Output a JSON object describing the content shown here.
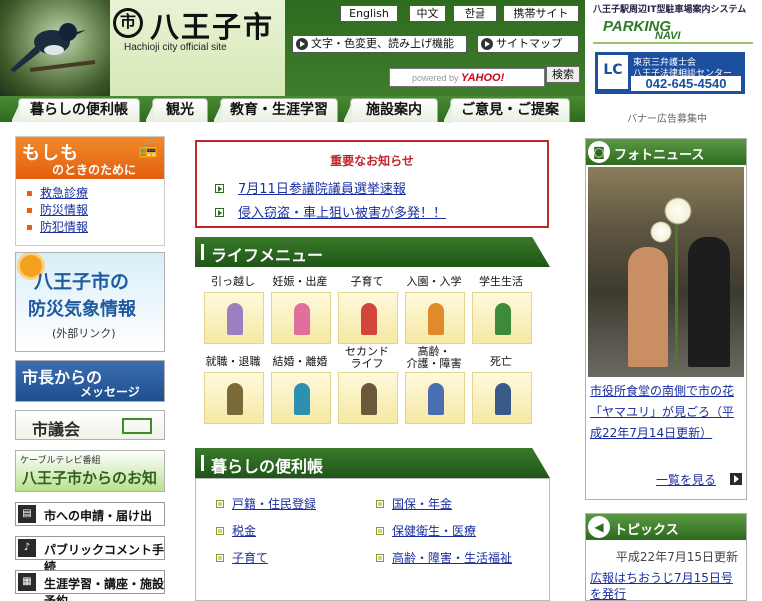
{
  "header": {
    "logo_mark": "市",
    "logo_title": "八王子市",
    "logo_subtitle": "Hachioji city official site",
    "languages": [
      "English",
      "中文",
      "한글",
      "携帯サイト"
    ],
    "accessibility_label": "文字・色変更、読み上げ機能",
    "sitemap_label": "サイトマップ",
    "search_placeholder": "powered by",
    "search_brand": "YAHOO!",
    "search_button": "検索"
  },
  "nav": {
    "tabs": [
      "暮らしの便利帳",
      "観光",
      "教育・生涯学習",
      "施設案内",
      "ご意見・ご提案"
    ]
  },
  "right_banners": {
    "parking_caption": "八王子駅周辺IT型駐車場案内システム",
    "parking_logo_1": "PARKING",
    "parking_logo_2": "NAVI",
    "lawyer_mark": "LC",
    "lawyer_line1": "東京三弁護士会",
    "lawyer_line2": "八王子法律相談センター",
    "lawyer_phone": "042-645-4540",
    "recruit": "バナー広告募集中"
  },
  "moshimo": {
    "title": "もしも",
    "subtitle": "のときのために",
    "icon": "radio-icon",
    "links": [
      "救急診療",
      "防災情報",
      "防犯情報"
    ]
  },
  "left_banners": {
    "bousai_line1": "八王子市の",
    "bousai_line2": "防災気象情報",
    "bousai_line3": "(外部リンク)",
    "mayor_line1": "市長からの",
    "mayor_line2": "メッセージ",
    "gikai": "市議会",
    "cable_line1": "ケーブルテレビ番組",
    "cable_line2": "八王子市からのお知らせ"
  },
  "left_buttons": [
    {
      "label": "市への申請・届け出",
      "icon": "document-icon"
    },
    {
      "label": "パブリックコメント手続",
      "icon": "microphone-icon"
    },
    {
      "label": "生涯学習・講座・施設予約",
      "icon": "grid-icon"
    }
  ],
  "notice": {
    "title": "重要なお知らせ",
    "items": [
      "7月11日参議院議員選挙速報",
      "侵入窃盗・車上狙い被害が多発！！"
    ]
  },
  "life_menu": {
    "title": "ライフメニュー",
    "items": [
      {
        "label": "引っ越し"
      },
      {
        "label": "妊娠・出産"
      },
      {
        "label": "子育て"
      },
      {
        "label": "入園・入学"
      },
      {
        "label": "学生生活"
      },
      {
        "label": "就職・退職"
      },
      {
        "label": "結婚・離婚"
      },
      {
        "label": "セカンド\nライフ"
      },
      {
        "label": "高齢・\n介護・障害"
      },
      {
        "label": "死亡"
      }
    ]
  },
  "kurashi": {
    "title": "暮らしの便利帳",
    "left_links": [
      "戸籍・住民登録",
      "税金",
      "子育て"
    ],
    "right_links": [
      "国保・年金",
      "保健衛生・医療",
      "高齢・障害・生活福祉"
    ]
  },
  "photo_news": {
    "title": "フォトニュース",
    "caption": "市役所食堂の南側で市の花「ヤマユリ」が見ごろ（平成22年7月14日更新）",
    "more": "一覧を見る"
  },
  "topics": {
    "title": "トピックス",
    "date": "平成22年7月15日更新",
    "item": "広報はちおうじ7月15日号を発行"
  },
  "colors": {
    "header_green": "#4f8a36",
    "dark_green": "#1f5518",
    "notice_red": "#c0262b",
    "moshimo_orange": "#e45f0f",
    "link_blue": "#1a2fa0"
  }
}
